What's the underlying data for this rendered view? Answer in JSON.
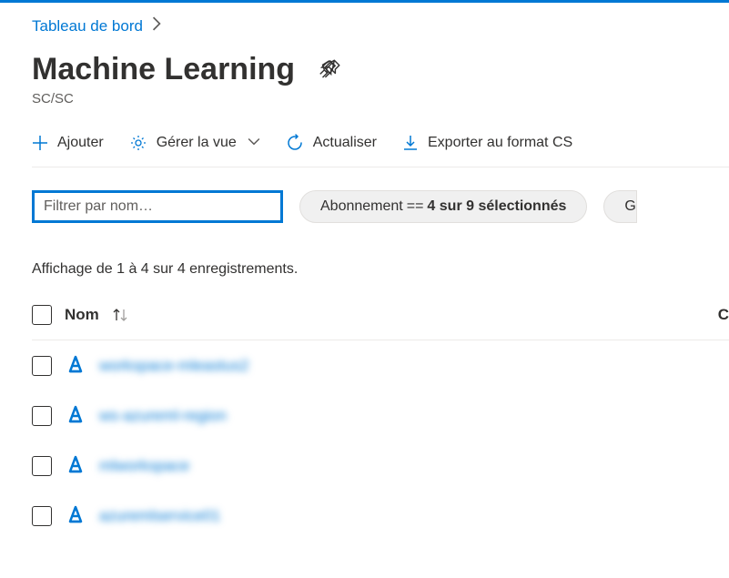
{
  "breadcrumb": {
    "root": "Tableau de bord"
  },
  "header": {
    "title": "Machine Learning",
    "subtitle": "SC/SC"
  },
  "toolbar": {
    "add": "Ajouter",
    "manage_view": "Gérer la vue",
    "refresh": "Actualiser",
    "export_csv": "Exporter au format CS"
  },
  "filters": {
    "placeholder": "Filtrer par nom…",
    "subscription_label": "Abonnement",
    "subscription_op": " == ",
    "subscription_value": "4 sur 9 sélectionnés",
    "partial_pill": "G"
  },
  "records_text": "Affichage de 1 à 4 sur 4 enregistrements.",
  "table": {
    "name_header": "Nom",
    "right_header": "C",
    "rows": [
      {
        "name": "workspace-mleastus2"
      },
      {
        "name": "ws-azureml-region"
      },
      {
        "name": "mlworkspace"
      },
      {
        "name": "azuremlservice01"
      }
    ]
  }
}
